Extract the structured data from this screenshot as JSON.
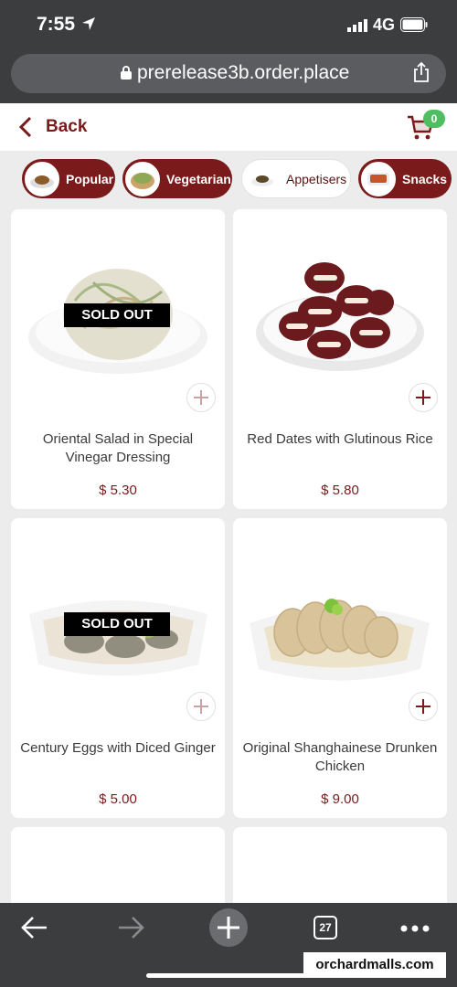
{
  "status_bar": {
    "time": "7:55",
    "network": "4G"
  },
  "browser": {
    "url": "prerelease3b.order.place",
    "tab_count": "27"
  },
  "header": {
    "back_label": "Back",
    "cart_count": "0"
  },
  "categories": [
    {
      "label": "Popular",
      "active": true
    },
    {
      "label": "Vegetarian",
      "active": true
    },
    {
      "label": "Appetisers",
      "active": false
    },
    {
      "label": "Snacks",
      "active": true
    }
  ],
  "products": [
    {
      "name": "Oriental Salad in Special Vinegar Dressing",
      "price": "$ 5.30",
      "sold_out": true,
      "sold_out_label": "SOLD OUT"
    },
    {
      "name": "Red Dates with Glutinous Rice",
      "price": "$ 5.80",
      "sold_out": false
    },
    {
      "name": "Century Eggs with Diced Ginger",
      "price": "$ 5.00",
      "sold_out": true,
      "sold_out_label": "SOLD OUT"
    },
    {
      "name": "Original Shanghainese Drunken Chicken",
      "price": "$ 9.00",
      "sold_out": false
    }
  ],
  "watermark": "orchardmalls.com",
  "colors": {
    "brand": "#7a1a1a",
    "badge": "#4fbd62",
    "chrome": "#3c3d3f"
  }
}
